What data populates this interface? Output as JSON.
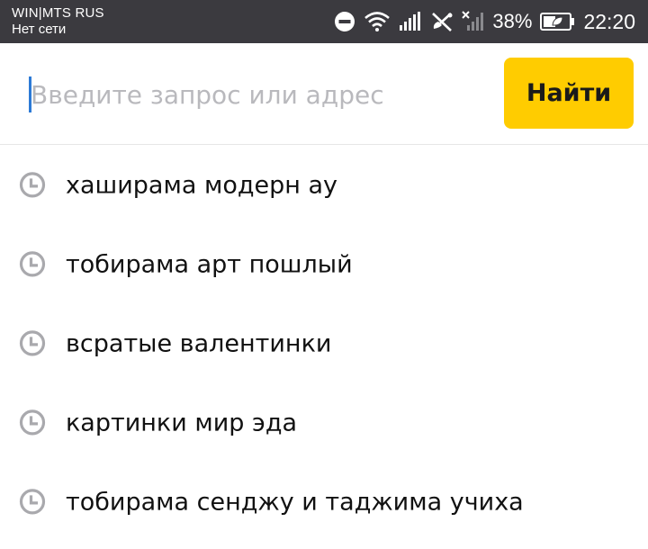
{
  "status_bar": {
    "carrier_name": "WIN|MTS RUS",
    "network_status": "Нет сети",
    "battery_percent": "38%",
    "time": "22:20",
    "icons": [
      "do-not-disturb-icon",
      "wifi-icon",
      "signal-icon",
      "no-calls-icon",
      "no-signal-icon",
      "battery-saver-icon"
    ]
  },
  "search": {
    "placeholder": "Введите запрос или адрес",
    "value": "",
    "button_label": "Найти",
    "button_color": "#ffcc00",
    "caret_color": "#2d7ad6"
  },
  "suggestions": [
    {
      "icon": "history-clock-icon",
      "text": "хаширама модерн ау"
    },
    {
      "icon": "history-clock-icon",
      "text": "тобирама арт пошлый"
    },
    {
      "icon": "history-clock-icon",
      "text": "всратые валентинки"
    },
    {
      "icon": "history-clock-icon",
      "text": "картинки мир эда"
    },
    {
      "icon": "history-clock-icon",
      "text": "тобирама сенджу и таджима учиха"
    }
  ]
}
